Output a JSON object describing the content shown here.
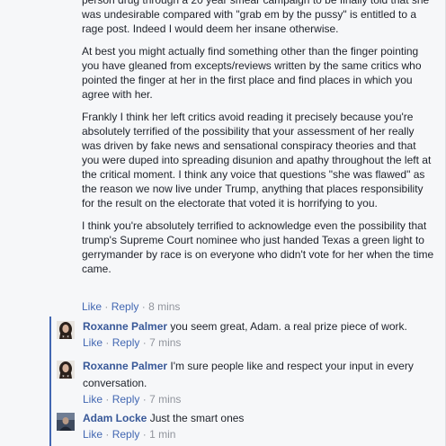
{
  "main_comment": {
    "paragraphs": [
      "person drug through a 20 year smear campaign to be finally told that she was undesirable compared with \"grab em by the pussy\" is entitled to a rage post. Indeed I would deem her insane otherwise.",
      "At best you might actually find something other than the finger pointing you have gleaned from excepts/reviews written by the same critics who pointed the finger at her in the first place and find places in which you agree with her.",
      "Frankly I think her left critics avoid reading it precisely because you're absolutely terrified of the possibility that your assessment of her really was driven by fake news and sensational conspiracy theories and that you were duped into spreading disunion and apathy throughout the left at the critical moment. I think any voice that questions \"she was flawed\" as the reason we now live under Trump, anything that places responsibility for the result on the electorate that voted it is horrifying to you.",
      "I think you're absolutely terrified to acknowledge even the possibility that trump's Supreme Court nominee who just handed Texas a green light to gerrymander by race is on everyone who didn't vote for her when the time came."
    ],
    "like_label": "Like",
    "reply_label": "Reply",
    "time": "8 mins"
  },
  "replies": [
    {
      "author": "Roxanne Palmer",
      "text": "you seem great, Adam. a real prize piece of work.",
      "like_label": "Like",
      "reply_label": "Reply",
      "time": "7 mins",
      "avatar": "roxanne-avatar"
    },
    {
      "author": "Roxanne Palmer",
      "text": "I'm sure people like and respect your input in every conversation.",
      "like_label": "Like",
      "reply_label": "Reply",
      "time": "7 mins",
      "avatar": "roxanne-avatar"
    },
    {
      "author": "Adam Locke",
      "text": "Just the smart ones",
      "like_label": "Like",
      "reply_label": "Reply",
      "time": "1 min",
      "avatar": "adam-avatar"
    }
  ],
  "separator": "·",
  "colors": {
    "link": "#4267b2",
    "author": "#385898",
    "meta": "#90949c",
    "text": "#1d2129",
    "background": "#f6f7f9",
    "reply_line": "#4267b2"
  }
}
